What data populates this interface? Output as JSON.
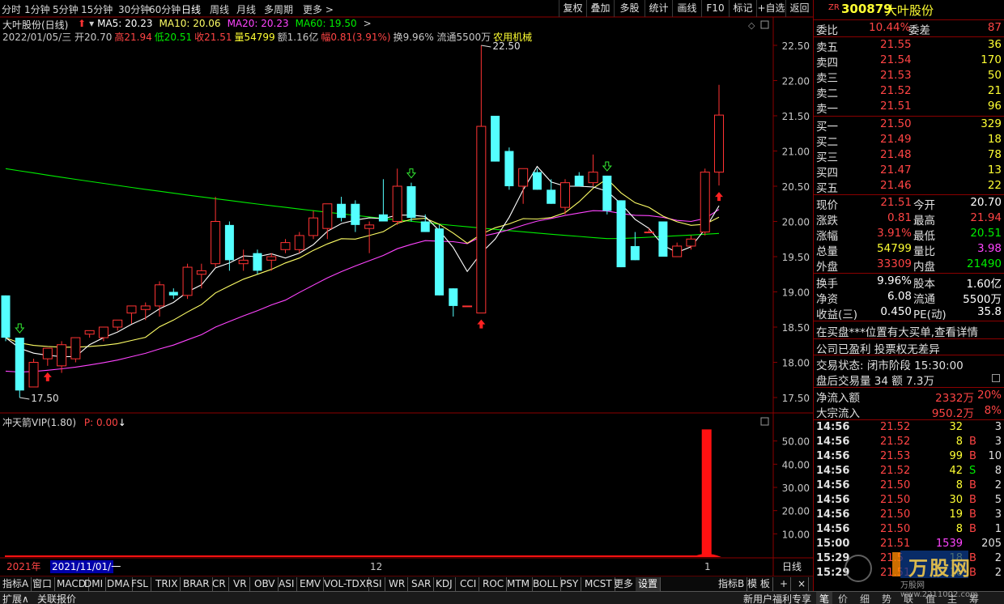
{
  "toolbar": {
    "periods": [
      "分时",
      "1分钟",
      "5分钟",
      "15分钟",
      "30分钟",
      "60分钟",
      "日线",
      "周线",
      "月线",
      "多周期",
      "更多 >"
    ],
    "active_period": "日线",
    "tools": [
      "复权",
      "叠加",
      "多股",
      "统计",
      "画线",
      "F10",
      "标记",
      "+自选",
      "返回"
    ]
  },
  "chart": {
    "stock_name": "大叶股份(日线)",
    "ma_labels": [
      {
        "text": "MA5: 20.23",
        "color": "#ffffff"
      },
      {
        "text": "MA10: 20.06",
        "color": "#ffff66"
      },
      {
        "text": "MA20: 20.23",
        "color": "#ff44ff"
      },
      {
        "text": "MA60: 19.50",
        "color": "#00ee00"
      }
    ],
    "info_line": [
      {
        "text": "2022/01/05/三 开20.70",
        "color": "#c8c8c8"
      },
      {
        "text": "高21.94",
        "color": "#ff4444"
      },
      {
        "text": "低20.51",
        "color": "#00ee00"
      },
      {
        "text": "收21.51",
        "color": "#ff4444"
      },
      {
        "text": "量54799",
        "color": "#ffff33"
      },
      {
        "text": "额1.16亿",
        "color": "#c8c8c8"
      },
      {
        "text": "幅0.81(3.91%)",
        "color": "#ff4444"
      },
      {
        "text": "换9.96% 流通5500万",
        "color": "#c8c8c8"
      },
      {
        "text": "农用机械",
        "color": "#ffff33"
      }
    ],
    "high_label": "22.50",
    "low_label": "17.50",
    "price_ticks": [
      "22.50",
      "22.00",
      "21.50",
      "21.00",
      "20.50",
      "20.00",
      "19.50",
      "19.00",
      "18.50",
      "18.00",
      "17.50"
    ],
    "indicator_title": "冲天箭VIP(1.80)",
    "indicator_value": "P: 0.00",
    "indicator_ticks": [
      "50.00",
      "40.00",
      "30.00",
      "20.00",
      "10.00"
    ],
    "date_year": "2021年",
    "date_range": "2021/11/01/一",
    "date_mark_12": "12",
    "date_mark_1": "1",
    "period_label": "日线"
  },
  "chart_data": {
    "type": "candlestick",
    "candles": [
      {
        "o": 18.95,
        "h": 18.95,
        "l": 18.3,
        "c": 18.35
      },
      {
        "o": 18.35,
        "h": 18.35,
        "l": 17.5,
        "c": 17.6
      },
      {
        "o": 17.65,
        "h": 18.05,
        "l": 17.65,
        "c": 18.0
      },
      {
        "o": 18.05,
        "h": 18.2,
        "l": 17.95,
        "c": 18.2
      },
      {
        "o": 17.95,
        "h": 18.3,
        "l": 17.85,
        "c": 18.25
      },
      {
        "o": 18.05,
        "h": 18.35,
        "l": 18.0,
        "c": 18.35
      },
      {
        "o": 18.4,
        "h": 18.45,
        "l": 18.35,
        "c": 18.45
      },
      {
        "o": 18.35,
        "h": 18.5,
        "l": 18.3,
        "c": 18.5
      },
      {
        "o": 18.5,
        "h": 18.6,
        "l": 18.45,
        "c": 18.6
      },
      {
        "o": 18.7,
        "h": 18.8,
        "l": 18.55,
        "c": 18.8
      },
      {
        "o": 18.75,
        "h": 18.85,
        "l": 18.6,
        "c": 18.8
      },
      {
        "o": 18.8,
        "h": 19.15,
        "l": 18.65,
        "c": 19.1
      },
      {
        "o": 19.0,
        "h": 19.05,
        "l": 18.9,
        "c": 18.95
      },
      {
        "o": 18.95,
        "h": 19.4,
        "l": 18.9,
        "c": 19.35
      },
      {
        "o": 19.25,
        "h": 19.4,
        "l": 19.05,
        "c": 19.3
      },
      {
        "o": 19.4,
        "h": 20.35,
        "l": 19.35,
        "c": 20.0
      },
      {
        "o": 19.95,
        "h": 20.0,
        "l": 19.3,
        "c": 19.45
      },
      {
        "o": 19.4,
        "h": 19.6,
        "l": 19.3,
        "c": 19.45
      },
      {
        "o": 19.55,
        "h": 19.6,
        "l": 19.25,
        "c": 19.3
      },
      {
        "o": 19.45,
        "h": 19.55,
        "l": 19.3,
        "c": 19.5
      },
      {
        "o": 19.6,
        "h": 19.75,
        "l": 19.55,
        "c": 19.7
      },
      {
        "o": 19.6,
        "h": 19.85,
        "l": 19.55,
        "c": 19.8
      },
      {
        "o": 19.8,
        "h": 20.15,
        "l": 19.75,
        "c": 20.05
      },
      {
        "o": 19.9,
        "h": 20.25,
        "l": 19.75,
        "c": 20.25
      },
      {
        "o": 20.25,
        "h": 20.35,
        "l": 20.0,
        "c": 20.05
      },
      {
        "o": 20.25,
        "h": 20.3,
        "l": 19.85,
        "c": 19.95
      },
      {
        "o": 19.9,
        "h": 20.0,
        "l": 19.55,
        "c": 19.95
      },
      {
        "o": 20.1,
        "h": 20.6,
        "l": 20.0,
        "c": 20.0
      },
      {
        "o": 20.0,
        "h": 20.75,
        "l": 19.95,
        "c": 20.5
      },
      {
        "o": 20.5,
        "h": 20.55,
        "l": 20.0,
        "c": 20.05
      },
      {
        "o": 20.0,
        "h": 20.1,
        "l": 19.85,
        "c": 19.85
      },
      {
        "o": 19.9,
        "h": 19.95,
        "l": 18.95,
        "c": 18.95
      },
      {
        "o": 19.05,
        "h": 19.05,
        "l": 18.65,
        "c": 18.8
      },
      {
        "o": 18.8,
        "h": 18.8,
        "l": 18.8,
        "c": 18.8
      },
      {
        "o": 18.7,
        "h": 22.5,
        "l": 18.7,
        "c": 21.35
      },
      {
        "o": 21.5,
        "h": 21.5,
        "l": 20.85,
        "c": 20.85
      },
      {
        "o": 21.0,
        "h": 21.05,
        "l": 20.45,
        "c": 20.5
      },
      {
        "o": 20.5,
        "h": 20.75,
        "l": 20.25,
        "c": 20.75
      },
      {
        "o": 20.7,
        "h": 20.75,
        "l": 20.45,
        "c": 20.45
      },
      {
        "o": 20.45,
        "h": 20.6,
        "l": 20.25,
        "c": 20.25
      },
      {
        "o": 20.2,
        "h": 20.6,
        "l": 20.1,
        "c": 20.55
      },
      {
        "o": 20.65,
        "h": 20.7,
        "l": 20.5,
        "c": 20.5
      },
      {
        "o": 20.55,
        "h": 20.95,
        "l": 20.5,
        "c": 20.7
      },
      {
        "o": 20.65,
        "h": 20.65,
        "l": 20.1,
        "c": 20.15
      },
      {
        "o": 20.3,
        "h": 20.3,
        "l": 19.35,
        "c": 19.35
      },
      {
        "o": 19.65,
        "h": 19.85,
        "l": 19.45,
        "c": 19.45
      },
      {
        "o": 19.85,
        "h": 19.9,
        "l": 19.85,
        "c": 19.85
      },
      {
        "o": 20.0,
        "h": 20.0,
        "l": 19.5,
        "c": 19.5
      },
      {
        "o": 19.5,
        "h": 19.7,
        "l": 19.5,
        "c": 19.65
      },
      {
        "o": 19.65,
        "h": 19.8,
        "l": 19.6,
        "c": 19.75
      },
      {
        "o": 19.85,
        "h": 20.75,
        "l": 19.8,
        "c": 20.7
      },
      {
        "o": 20.7,
        "h": 21.94,
        "l": 20.51,
        "c": 21.51
      }
    ],
    "volume_spike_value": 55.0,
    "indicator_ymax": 60
  },
  "sidepanel": {
    "code_prefix": "ZR",
    "code": "300879",
    "name": "大叶股份",
    "ratio": {
      "label": "委比",
      "value": "10.44%",
      "label2": "委差",
      "value2": "87"
    },
    "asks": [
      {
        "label": "卖五",
        "price": "21.55",
        "vol": "36"
      },
      {
        "label": "卖四",
        "price": "21.54",
        "vol": "170"
      },
      {
        "label": "卖三",
        "price": "21.53",
        "vol": "50"
      },
      {
        "label": "卖二",
        "price": "21.52",
        "vol": "21"
      },
      {
        "label": "卖一",
        "price": "21.51",
        "vol": "96"
      }
    ],
    "bids": [
      {
        "label": "买一",
        "price": "21.50",
        "vol": "329"
      },
      {
        "label": "买二",
        "price": "21.49",
        "vol": "18"
      },
      {
        "label": "买三",
        "price": "21.48",
        "vol": "78"
      },
      {
        "label": "买四",
        "price": "21.47",
        "vol": "13"
      },
      {
        "label": "买五",
        "price": "21.46",
        "vol": "22"
      }
    ],
    "stats": [
      {
        "l1": "现价",
        "v1": "21.51",
        "c1": "#ff4444",
        "l2": "今开",
        "v2": "20.70",
        "c2": "#ffffff"
      },
      {
        "l1": "涨跌",
        "v1": "0.81",
        "c1": "#ff4444",
        "l2": "最高",
        "v2": "21.94",
        "c2": "#ff4444"
      },
      {
        "l1": "涨幅",
        "v1": "3.91%",
        "c1": "#ff4444",
        "l2": "最低",
        "v2": "20.51",
        "c2": "#00ee00"
      },
      {
        "l1": "总量",
        "v1": "54799",
        "c1": "#ffff33",
        "l2": "量比",
        "v2": "3.98",
        "c2": "#ff44ff"
      },
      {
        "l1": "外盘",
        "v1": "33309",
        "c1": "#ff4444",
        "l2": "内盘",
        "v2": "21490",
        "c2": "#00ee00"
      }
    ],
    "stats2": [
      {
        "l1": "换手",
        "v1": "9.96%",
        "l2": "股本",
        "v2": "1.60亿"
      },
      {
        "l1": "净资",
        "v1": "6.08",
        "l2": "流通",
        "v2": "5500万"
      },
      {
        "l1": "收益(三)",
        "v1": "0.450",
        "l2": "PE(动)",
        "v2": "35.8"
      }
    ],
    "notice1": "在买盘***位置有大买单,查看详情",
    "notice2": "公司已盈利 投票权无差异",
    "trade_state": "交易状态: 闭市阶段 15:30:00",
    "after_hours": "盘后交易量 34 额 7.3万",
    "net_inflow": {
      "label": "净流入额",
      "value": "2332万",
      "pct": "20%"
    },
    "block_inflow": {
      "label": "大宗流入",
      "value": "950.2万",
      "pct": "8%"
    },
    "ticks": [
      {
        "t": "14:56",
        "p": "21.52",
        "v": "32",
        "bs": "",
        "n": "3",
        "pc": "#ff4444",
        "vc": "#ffff33"
      },
      {
        "t": "14:56",
        "p": "21.52",
        "v": "8",
        "bs": "B",
        "n": "3",
        "pc": "#ff4444",
        "vc": "#ffff33"
      },
      {
        "t": "14:56",
        "p": "21.53",
        "v": "99",
        "bs": "B",
        "n": "10",
        "pc": "#ff4444",
        "vc": "#ffff33"
      },
      {
        "t": "14:56",
        "p": "21.52",
        "v": "42",
        "bs": "S",
        "n": "8",
        "pc": "#ff4444",
        "vc": "#ffff33"
      },
      {
        "t": "14:56",
        "p": "21.50",
        "v": "8",
        "bs": "B",
        "n": "2",
        "pc": "#ff4444",
        "vc": "#ffff33"
      },
      {
        "t": "14:56",
        "p": "21.50",
        "v": "30",
        "bs": "B",
        "n": "5",
        "pc": "#ff4444",
        "vc": "#ffff33"
      },
      {
        "t": "14:56",
        "p": "21.50",
        "v": "19",
        "bs": "B",
        "n": "3",
        "pc": "#ff4444",
        "vc": "#ffff33"
      },
      {
        "t": "14:56",
        "p": "21.50",
        "v": "8",
        "bs": "B",
        "n": "1",
        "pc": "#ff4444",
        "vc": "#ffff33"
      },
      {
        "t": "15:00",
        "p": "21.51",
        "v": "1539",
        "bs": "",
        "n": "205",
        "pc": "#ff4444",
        "vc": "#ff44ff"
      },
      {
        "t": "15:29",
        "p": "21.5",
        "v": "18",
        "bs": "B",
        "n": "2",
        "pc": "#ff4444",
        "vc": "#ffff33"
      },
      {
        "t": "15:29",
        "p": "21.51",
        "v": "16",
        "bs": "B",
        "n": "2",
        "pc": "#ff4444",
        "vc": "#ffff33"
      }
    ]
  },
  "indicators": {
    "items": [
      "指标A",
      "窗口",
      "MACD",
      "DMI",
      "DMA",
      "FSL",
      "TRIX",
      "BRAR",
      "CR",
      "VR",
      "OBV",
      "ASI",
      "EMV",
      "VOL-TDX",
      "RSI",
      "WR",
      "SAR",
      "KDJ",
      "CCI",
      "ROC",
      "MTM",
      "BOLL",
      "PSY",
      "MCST",
      "更多",
      "设置"
    ],
    "active": "设置",
    "right_items": [
      "指标B",
      "模 板",
      "+",
      "×"
    ]
  },
  "status": {
    "left1": "扩展∧",
    "left2": "关联报价",
    "promo": "新用户福利专享",
    "tabs": [
      "笔",
      "价",
      "细",
      "势",
      "联",
      "值",
      "主",
      "筹"
    ],
    "watermark": "万股网 www.2211002.com"
  },
  "colors": {
    "up": "#ff3333",
    "down": "#54ffff",
    "ma5": "#ffffff",
    "ma10": "#ffff66",
    "ma20": "#ff44ff",
    "ma60": "#00ee00",
    "grid": "#8b0000"
  }
}
